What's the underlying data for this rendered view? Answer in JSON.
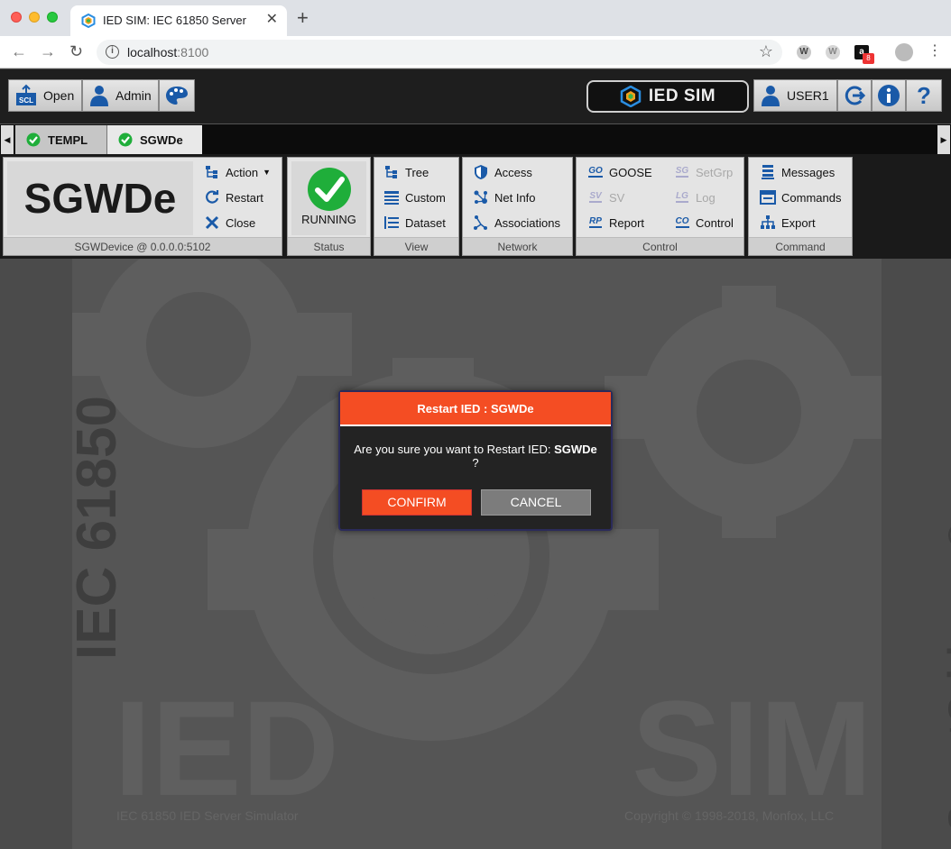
{
  "browser": {
    "tab_title": "IED SIM: IEC 61850 Server",
    "url_host": "localhost",
    "url_port": ":8100",
    "new_tab": "+",
    "close_tab": "✕",
    "back": "←",
    "forward": "→",
    "reload": "↻",
    "star": "☆",
    "info": "i",
    "ext_badge": "8"
  },
  "toolbar": {
    "open_label": "Open",
    "admin_label": "Admin",
    "brand": "IED SIM",
    "user_label": "USER1"
  },
  "device_tabs": [
    {
      "label": "TEMPL"
    },
    {
      "label": "SGWDe"
    }
  ],
  "ribbon": {
    "device": {
      "name": "SGWDe",
      "address": "SGWDevice @ 0.0.0.0:5102"
    },
    "actions": {
      "action": "Action",
      "restart": "Restart",
      "close": "Close"
    },
    "status": {
      "label": "RUNNING",
      "title": "Status"
    },
    "view": {
      "title": "View",
      "items": [
        "Tree",
        "Custom",
        "Dataset"
      ]
    },
    "network": {
      "title": "Network",
      "items": [
        "Access",
        "Net Info",
        "Associations"
      ]
    },
    "control": {
      "title": "Control",
      "left": [
        {
          "code": "GO",
          "label": "GOOSE"
        },
        {
          "code": "SV",
          "label": "SV"
        },
        {
          "code": "RP",
          "label": "Report"
        }
      ],
      "right": [
        {
          "code": "SG",
          "label": "SetGrp"
        },
        {
          "code": "LG",
          "label": "Log"
        },
        {
          "code": "CO",
          "label": "Control"
        }
      ]
    },
    "command": {
      "title": "Command",
      "items": [
        "Messages",
        "Commands",
        "Export"
      ]
    }
  },
  "background": {
    "left_vertical": "IEC 61850",
    "right_vertical": "SmartGridware ®",
    "word_left": "IED",
    "word_right": "SIM",
    "footer_left": "IEC 61850 IED Server Simulator",
    "footer_right": "Copyright © 1998-2018, Monfox, LLC"
  },
  "dialog": {
    "title": "Restart IED : SGWDe",
    "message_prefix": "Are you sure you want to Restart IED: ",
    "message_device": "SGWDe",
    "message_suffix": "?",
    "confirm": "CONFIRM",
    "cancel": "CANCEL"
  },
  "colors": {
    "accent": "#f44d23",
    "running": "#1fae3a",
    "icon_blue": "#1a5aa8"
  }
}
